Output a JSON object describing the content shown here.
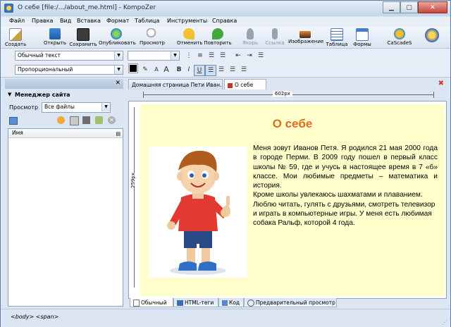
{
  "window": {
    "title": "О себе [file:/.../about_me.html] - KompoZer"
  },
  "menu": [
    "Файл",
    "Правка",
    "Вид",
    "Вставка",
    "Формат",
    "Таблица",
    "Инструменты",
    "Справка"
  ],
  "toolbar": {
    "items": [
      {
        "label": "Создать",
        "icon": "new-doc-icon",
        "enabled": true
      },
      {
        "label": "Открыть",
        "icon": "open-folder-icon",
        "enabled": true
      },
      {
        "label": "Сохранить",
        "icon": "save-floppy-icon",
        "enabled": true
      },
      {
        "label": "Опубликовать",
        "icon": "publish-globe-icon",
        "enabled": true
      },
      {
        "label": "Просмотр",
        "icon": "preview-magnifier-icon",
        "enabled": true
      },
      {
        "label": "Отменить",
        "icon": "undo-arrow-icon",
        "enabled": true
      },
      {
        "label": "Повторить",
        "icon": "redo-arrow-icon",
        "enabled": true
      },
      {
        "label": "Якорь",
        "icon": "anchor-icon",
        "enabled": false
      },
      {
        "label": "Ссылка",
        "icon": "link-chain-icon",
        "enabled": false
      },
      {
        "label": "Изображение",
        "icon": "image-icon",
        "enabled": true
      },
      {
        "label": "Таблица",
        "icon": "table-icon",
        "enabled": true
      },
      {
        "label": "Формы",
        "icon": "forms-icon",
        "enabled": true
      },
      {
        "label": "CaScadeS",
        "icon": "cascades-icon",
        "enabled": true
      }
    ]
  },
  "format": {
    "paragraph_style": "Обычный текст",
    "font": "Пропорциональный",
    "font_size_value": ""
  },
  "site_manager": {
    "title": "Менеджер сайта",
    "view_label": "Просмотр",
    "view_value": "Все файлы",
    "column_name": "Имя"
  },
  "tabs": [
    {
      "label": "Домашняя страница Пети Иван..."
    },
    {
      "label": "О себе"
    }
  ],
  "ruler": {
    "width_label": "602px",
    "height_label": "259px"
  },
  "document": {
    "heading": "О себе",
    "paragraph": "Меня зовут Иванов Петя. Я родился 21 мая 2000 года в городе Перми. В 2009 году пошел в первый класс школы № 59, где и учусь в настоящее время в 7 «б» классе. Мои любимые предметы – математика и история.",
    "paragraph2": "Кроме школы увлекаюсь шахматами и плаванием. Люблю читать, гулять с друзьями, смотреть телевизор и играть в компьютерные игры. У меня есть любимая собака Ральф, которой 4 года.",
    "page_bg": "#ffffcc",
    "heading_color": "#e26b1d"
  },
  "view_tabs": [
    {
      "label": "Обычный"
    },
    {
      "label": "HTML-теги"
    },
    {
      "label": "Код"
    },
    {
      "label": "Предварительный просмотр"
    }
  ],
  "status": {
    "path": "<body>  <span>"
  }
}
